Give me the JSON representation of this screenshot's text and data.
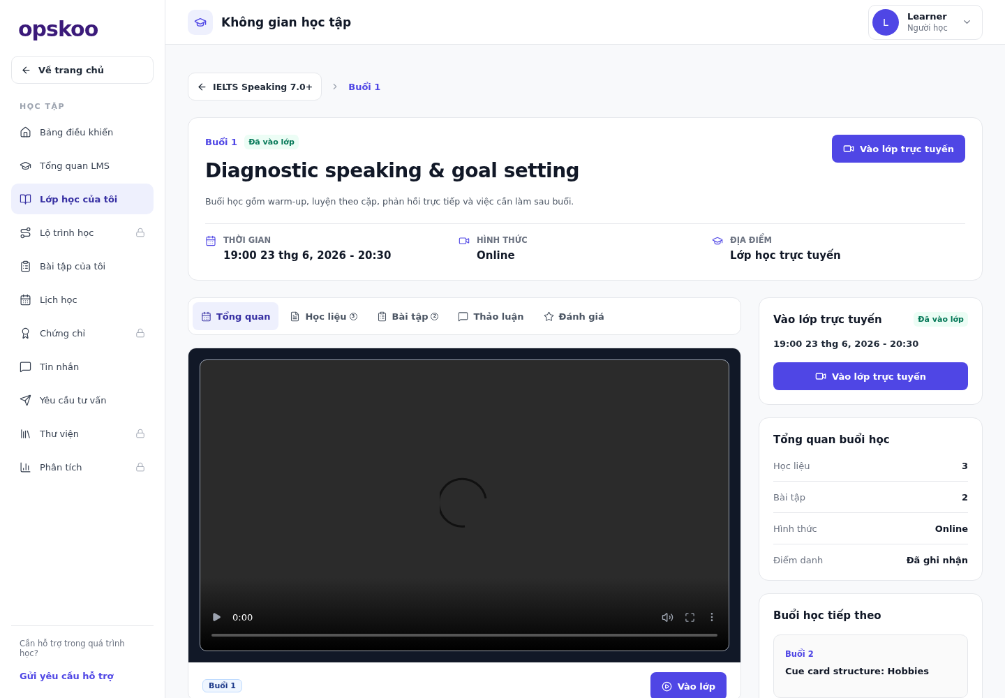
{
  "brand": {
    "logo": "opskoo"
  },
  "sidebar": {
    "back_link": "Về trang chủ",
    "section_title": "HỌC TẬP",
    "items": [
      {
        "label": "Bảng điều khiển",
        "selected": false,
        "locked": false
      },
      {
        "label": "Tổng quan LMS",
        "selected": false,
        "locked": false
      },
      {
        "label": "Lớp học của tôi",
        "selected": true,
        "locked": false
      },
      {
        "label": "Lộ trình học",
        "selected": false,
        "locked": true
      },
      {
        "label": "Bài tập của tôi",
        "selected": false,
        "locked": false
      },
      {
        "label": "Lịch học",
        "selected": false,
        "locked": false
      },
      {
        "label": "Chứng chỉ",
        "selected": false,
        "locked": true
      },
      {
        "label": "Tin nhắn",
        "selected": false,
        "locked": false
      },
      {
        "label": "Yêu cầu tư vấn",
        "selected": false,
        "locked": false
      },
      {
        "label": "Thư viện",
        "selected": false,
        "locked": true
      },
      {
        "label": "Phân tích",
        "selected": false,
        "locked": true
      }
    ],
    "help_text": "Cần hỗ trợ trong quá trình học?",
    "help_link": "Gửi yêu cầu hỗ trợ"
  },
  "header": {
    "title": "Không gian học tập",
    "user": {
      "avatar": "L",
      "name": "Learner",
      "role": "Người học"
    }
  },
  "breadcrumb": {
    "back": "IELTS Speaking 7.0+",
    "current": "Buổi 1"
  },
  "session": {
    "label": "Buổi 1",
    "status": "Đã vào lớp",
    "title": "Diagnostic speaking & goal setting",
    "description": "Buổi học gồm warm-up, luyện theo cặp, phản hồi trực tiếp và việc cần làm sau buổi.",
    "join_button": "Vào lớp trực tuyến",
    "meta": [
      {
        "label": "THỜI GIAN",
        "value": "19:00 23 thg 6, 2026 - 20:30"
      },
      {
        "label": "HÌNH THỨC",
        "value": "Online"
      },
      {
        "label": "ĐỊA ĐIỂM",
        "value": "Lớp học trực tuyến"
      }
    ]
  },
  "tabs": [
    {
      "label": "Tổng quan",
      "selected": true
    },
    {
      "label": "Học liệu",
      "count": "3",
      "selected": false
    },
    {
      "label": "Bài tập",
      "count": "2",
      "selected": false
    },
    {
      "label": "Thảo luận",
      "selected": false
    },
    {
      "label": "Đánh giá",
      "selected": false
    }
  ],
  "video": {
    "time": "0:00"
  },
  "session_footer": {
    "badge": "Buổi 1",
    "button": "Vào lớp"
  },
  "join_card": {
    "title": "Vào lớp trực tuyến",
    "status": "Đã vào lớp",
    "time": "19:00 23 thg 6, 2026 - 20:30",
    "button": "Vào lớp trực tuyến"
  },
  "overview": {
    "title": "Tổng quan buổi học",
    "rows": [
      {
        "label": "Học liệu",
        "value": "3"
      },
      {
        "label": "Bài tập",
        "value": "2"
      },
      {
        "label": "Hình thức",
        "value": "Online"
      },
      {
        "label": "Điểm danh",
        "value": "Đã ghi nhận"
      }
    ]
  },
  "next_session": {
    "title": "Buổi học tiếp theo",
    "label": "Buổi 2",
    "name": "Cue card structure: Hobbies"
  }
}
